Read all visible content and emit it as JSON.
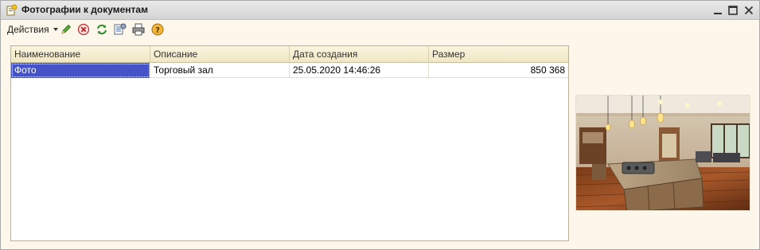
{
  "window": {
    "title": "Фотографии к документам"
  },
  "toolbar": {
    "actions_label": "Действия"
  },
  "table": {
    "columns": [
      "Наименование",
      "Описание",
      "Дата создания",
      "Размер"
    ],
    "rows": [
      {
        "name": "Фото",
        "description": "Торговый зал",
        "created": "25.05.2020 14:46:26",
        "size": "850 368"
      }
    ]
  }
}
